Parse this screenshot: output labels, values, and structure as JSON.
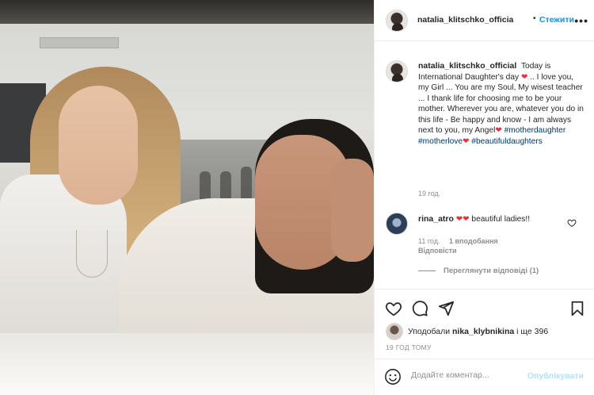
{
  "post": {
    "username": "natalia_klitschko_officia",
    "follow_label": "Стежити",
    "more_label": "•••"
  },
  "caption": {
    "username": "natalia_klitschko_official",
    "text_1": "Today is International Daughter's day",
    "text_2": ".. I love you, my Girl ... You are my Soul, My wisest teacher ... I thank life for choosing me to be your mother. Wherever you are, whatever you do in this life - Be happy and know - I am always next to you, my Angel",
    "tag_1": "#motherdaughter",
    "tag_2": "#motherlove",
    "tag_3": "#beautifuldaughters",
    "time": "19 год."
  },
  "comment": {
    "username": "rina_atro",
    "text": "beautiful ladies!!",
    "time": "11 год.",
    "likes": "1 вподобання",
    "reply": "Відповісти",
    "view_replies": "Переглянути відповіді (1)"
  },
  "likes": {
    "prefix": "Уподобали",
    "user": "nika_klybnikina",
    "suffix": "і ще 396"
  },
  "posted_ago": "19 ГОД ТОМУ",
  "add_comment": {
    "placeholder": "Додайте коментар...",
    "publish_label": "Опублікувати"
  },
  "icons": {
    "heart": "heart-icon",
    "comment": "comment-icon",
    "share": "paper-plane-icon",
    "save": "bookmark-icon",
    "emoji": "smiley-icon"
  },
  "colors": {
    "accent": "#0095f6",
    "heart_red": "#ed2f3c",
    "muted": "#8e8e8e"
  }
}
